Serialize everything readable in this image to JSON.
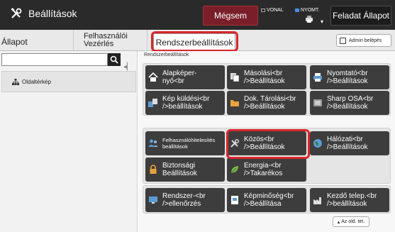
{
  "header": {
    "title": "Beállítások",
    "cancel_label": "Mégsem",
    "indicator_line": "VONAL",
    "indicator_print": "NYOMT.",
    "job_status_label": "Feladat Állapot"
  },
  "tabs": {
    "status": "Állapot",
    "user_control": "Felhasználói\nVezérlés",
    "system_settings": "Rendszerbeállítások",
    "admin_login": "Admin belépés"
  },
  "sidebar": {
    "search_placeholder": "",
    "sitemap_label": "Oldaltérkép"
  },
  "main": {
    "section_title": "Rendszerbeállítások",
    "tiles": [
      {
        "label": "Alapképer-\nnyő<br",
        "icon": "home-icon"
      },
      {
        "label": "Másolási<br\n/>Beállítások",
        "icon": "copy-icon"
      },
      {
        "label": "Nyomtató<br\n/>Beállítások",
        "icon": "printer-icon"
      },
      {
        "label": "Kép küldési<br\n/>beállítások",
        "icon": "send-icon"
      },
      {
        "label": "Dok. Tárolási<br\n/>Beállítások",
        "icon": "folder-icon"
      },
      {
        "label": "Sharp OSA<br\n/>Beállítások",
        "icon": "osa-icon"
      },
      {
        "label": "Felhasználóhitelesítés\nbeállítások",
        "icon": "users-icon"
      },
      {
        "label": "Közös<br\n/>Beállítások",
        "icon": "tools-icon"
      },
      {
        "label": "Hálózati<br\n/>Beállítások",
        "icon": "globe-icon"
      },
      {
        "label": "Biztonsági\nBeállítások",
        "icon": "lock-icon"
      },
      {
        "label": "Energia-<br\n/>Takarékos",
        "icon": "leaf-icon"
      },
      {
        "label": "Rendszer-<br\n/>ellenőrzés",
        "icon": "monitor-icon"
      },
      {
        "label": "Képminőség<br\n/>Beállítása",
        "icon": "document-icon"
      },
      {
        "label": "Kezdő telep.<br\n/>beállítások",
        "icon": "factory-icon"
      }
    ]
  },
  "footer": {
    "up_label": "Az old. tet."
  }
}
